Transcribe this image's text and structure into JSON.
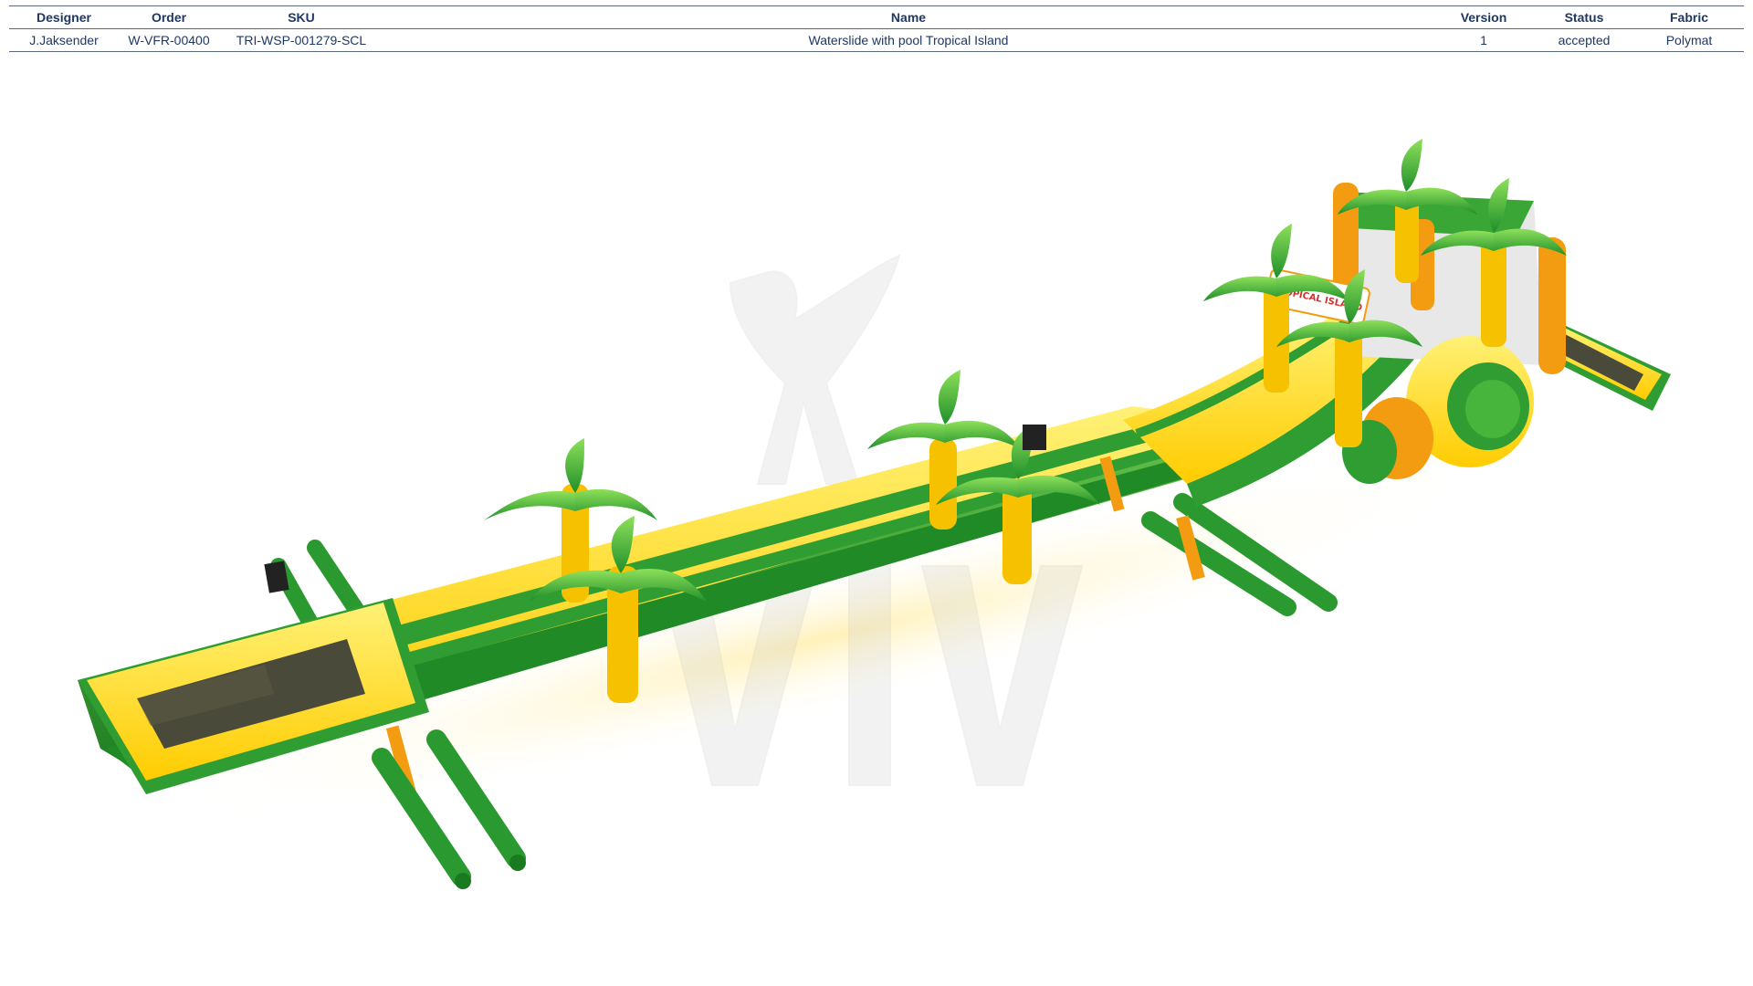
{
  "spec_table": {
    "headers": {
      "designer": "Designer",
      "order": "Order",
      "sku": "SKU",
      "name": "Name",
      "version": "Version",
      "status": "Status",
      "fabric": "Fabric"
    },
    "row": {
      "designer": "J.Jaksender",
      "order": "W-VFR-00400",
      "sku": "TRI-WSP-001279-SCL",
      "name": "Waterslide with pool Tropical Island",
      "version": "1",
      "status": "accepted",
      "fabric": "Polymat"
    }
  },
  "product_render": {
    "sign_text": "TROPICAL ISLAND",
    "colors": {
      "yellow": "#ffd400",
      "light_yellow": "#ffeb3b",
      "green": "#3aa635",
      "dark_green": "#1e7d22",
      "orange": "#f39c12",
      "pool_water": "#4a4a3a"
    }
  }
}
